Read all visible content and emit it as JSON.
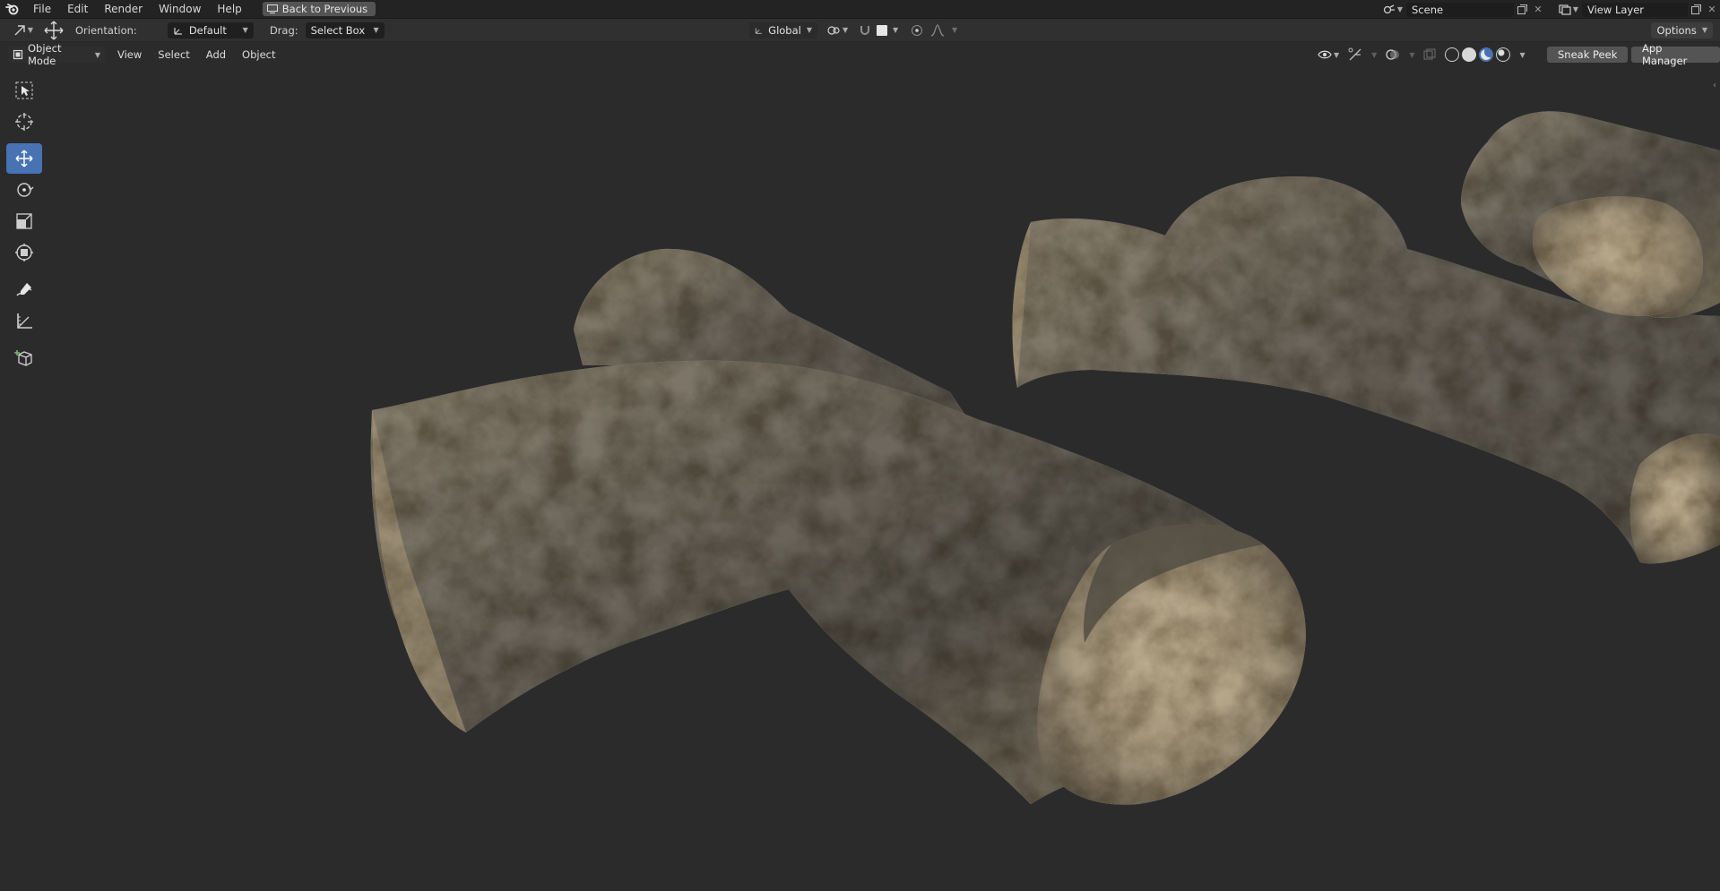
{
  "menu": {
    "items": [
      "File",
      "Edit",
      "Render",
      "Window",
      "Help"
    ],
    "back_label": "Back to Previous"
  },
  "scene": {
    "name": "Scene",
    "view_layer": "View Layer"
  },
  "tool_header": {
    "orientation_label": "Orientation:",
    "orientation_value": "Default",
    "drag_label": "Drag:",
    "drag_value": "Select Box",
    "transform_space": "Global",
    "options_label": "Options"
  },
  "viewport_header": {
    "mode": "Object Mode",
    "menus": [
      "View",
      "Select",
      "Add",
      "Object"
    ],
    "sneak_peek": "Sneak Peek",
    "app_manager": "App Manager"
  },
  "toolbar": {
    "tools": [
      "select-box-icon",
      "cursor-icon",
      "move-icon",
      "rotate-icon",
      "scale-icon",
      "transform-icon",
      "annotate-icon",
      "measure-icon",
      "add-cube-icon"
    ],
    "active": "move-icon"
  },
  "colors": {
    "accent": "#4772b3",
    "background": "#2b2b2b",
    "rock_dark": "#5d574c",
    "rock_light": "#b7a990"
  }
}
